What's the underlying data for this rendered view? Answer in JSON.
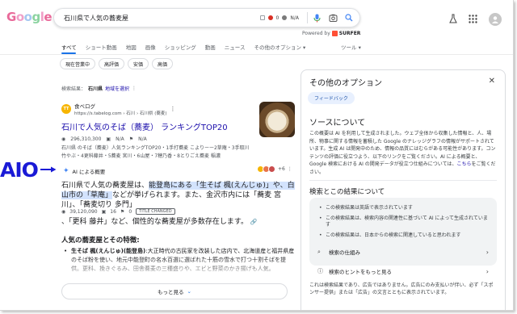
{
  "logo": "Google",
  "search": {
    "query": "石川県で人気の蕎麦屋",
    "ext_value_1": "0",
    "ext_value_2": "N/A"
  },
  "powered": {
    "prefix": "Powered by",
    "brand": "SURFER"
  },
  "tabs": [
    "すべて",
    "ショート動画",
    "地図",
    "画像",
    "ショッピング",
    "動画",
    "ニュース",
    "その他のオプション ▾"
  ],
  "tools": "ツール ▾",
  "chips": [
    "現在営業中",
    "高評価",
    "安価",
    "高価"
  ],
  "results_info": {
    "prefix": "検索結果：",
    "location": "石川県",
    "link": "地域を選択"
  },
  "result1": {
    "site_icon": "TT",
    "site_name": "食べログ",
    "site_url": "https://s.tabelog.com › 石川 › 石川県 (蕎麦)",
    "title": "石川で人気のそば（蕎麦） ランキングTOP20",
    "views": "296,310,300",
    "metric_a": "N/A",
    "metric_b": "N/A",
    "snippet": "石川県 のそば（蕎麦）人気ランキングTOP20・1手打蕎麦 こよりーー2草庵・3手取川 竹やぶ・4更科藤井・5蕎麦 宮川・6山屋・7穂乃香・8とりごえ蕎麦 稲濃"
  },
  "aio": {
    "label": "AIO",
    "header": "AI による概要",
    "more_count": "+6",
    "text_pre": "石川県で人気の蕎麦屋は、",
    "text_hl": "能登島にある「生そば 楓(えんじゅ)」や、白山市の「草庵」",
    "text_post": "などが挙げられます。また、金沢市内には「蕎麦 宮川」、「蕎麦切り 多門」",
    "views": "39,120,090",
    "metric_a": "16",
    "metric_b": "0",
    "badge": "TITLE CHANGED",
    "text2": "、「更科 藤井」など、個性的な蕎麦屋が多数存在します。",
    "subheading": "人気の蕎麦屋とその特徴:",
    "bullet_bold": "生そば 楓(えんじゅ)(能登島)",
    "bullet_text": ":大正時代の古民家を改装した店内で、北海道産と福井県産のそば粉を使い、地元中能登町の名水百選に選ばれた十筋の雪水で打つ十割そばを提供。更科、挽きぐるみ、田舎蕎麦の三種盛りや、エビと野菜のかき揚げも人気。",
    "more_button": "もっと見る"
  },
  "panel": {
    "title": "その他のオプション",
    "feedback": "フィードバック",
    "source_title": "ソースについて",
    "source_text": "この概要は AI を利用して生成されました。ウェブ全体から収集した情報と、人、場所、物事に関する情報を蓄積した Google のナレッジグラフの情報がサポートされています。生成 AI は開発中のため、情報の品質にはむらがある可能性があります。コンテンツの評価に役立つよう、以下のリンクをご覧ください。AI による概要と、Google 検索における AI の開発データが役立つ仕組みについては、",
    "source_link": "こちら",
    "source_end": "をご覧ください。",
    "search_about": "検索とこの結果について",
    "info1": "この検索結果は英語で表示されています",
    "info2": "この検索結果は、検索内容の関連性に基づいて AI によって生成されています",
    "info3": "この検索結果は、日本からの検索に関連していると思われます",
    "row1": "検索の仕組み",
    "row2": "検索のヒントをもっと見る",
    "footer": "これは検索結果であり、広告ではありません。広告にのみ支払いが伴い、必ず「スポンサー提供」または「広告」の文言とともに表示されています。"
  },
  "colors": {
    "link": "#1a0dab",
    "accent": "#1a73e8",
    "aio_label": "#1a1ad6",
    "highlight": "#d3e3fd"
  }
}
